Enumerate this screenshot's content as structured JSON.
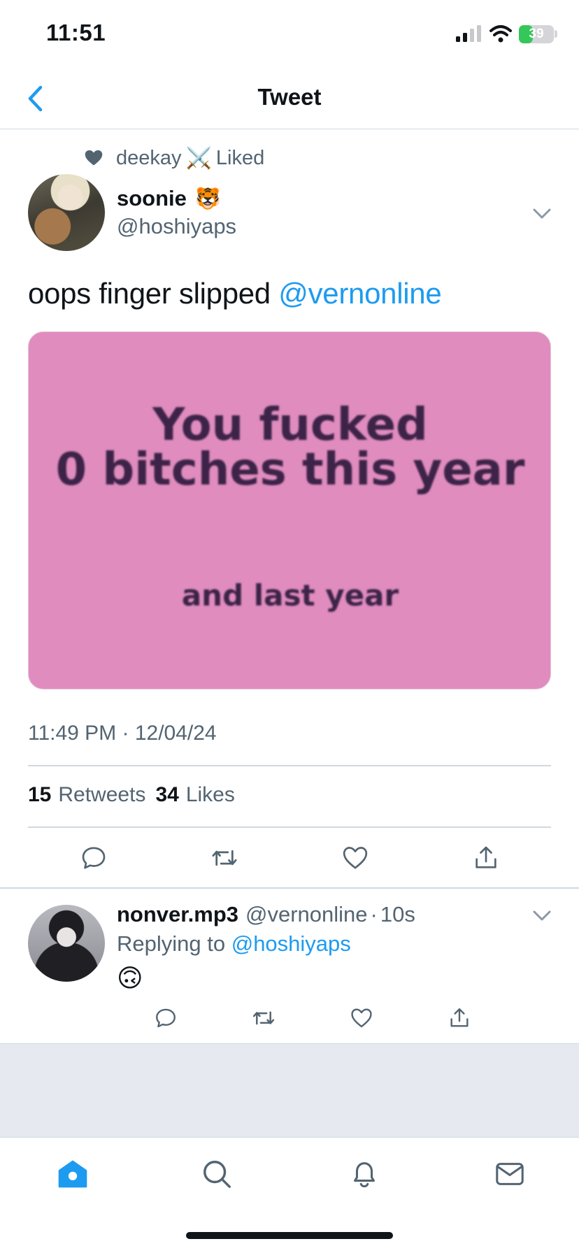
{
  "status_bar": {
    "time": "11:51",
    "battery": "39",
    "battery_level": 0.39,
    "battery_color": "#34c759",
    "icons": [
      "signal-icon",
      "wifi-icon",
      "battery-icon"
    ]
  },
  "nav": {
    "title": "Tweet",
    "back_icon": "chevron-left-icon"
  },
  "social_context": {
    "icon": "heart-icon",
    "user": "deekay",
    "emoji": "⚔️",
    "action": "Liked"
  },
  "tweet": {
    "author": {
      "name": "soonie",
      "emoji": "🐯",
      "handle": "@hoshiyaps"
    },
    "text": "oops finger slipped",
    "mention": "@vernonline",
    "media": {
      "line1": "You fucked",
      "line2": "0 bitches this year",
      "line3": "and last year",
      "background": "#e08cbf"
    },
    "timestamp": "11:49 PM · 12/04/24",
    "stats": {
      "retweets_count": "15",
      "retweets_label": "Retweets",
      "likes_count": "34",
      "likes_label": "Likes"
    }
  },
  "reply": {
    "name": "nonver.mp3",
    "handle": "@vernonline",
    "dot": "·",
    "time": "10s",
    "replying_prefix": "Replying to",
    "replying_to": "@hoshiyaps",
    "text": "🙃"
  },
  "tab_bar": {
    "tabs": [
      "home-icon",
      "search-icon",
      "bell-icon",
      "mail-icon"
    ],
    "active_color": "#1d9bf0"
  },
  "colors": {
    "accent": "#1d9bf0",
    "secondary_text": "#536471",
    "divider": "#cfd9de"
  }
}
